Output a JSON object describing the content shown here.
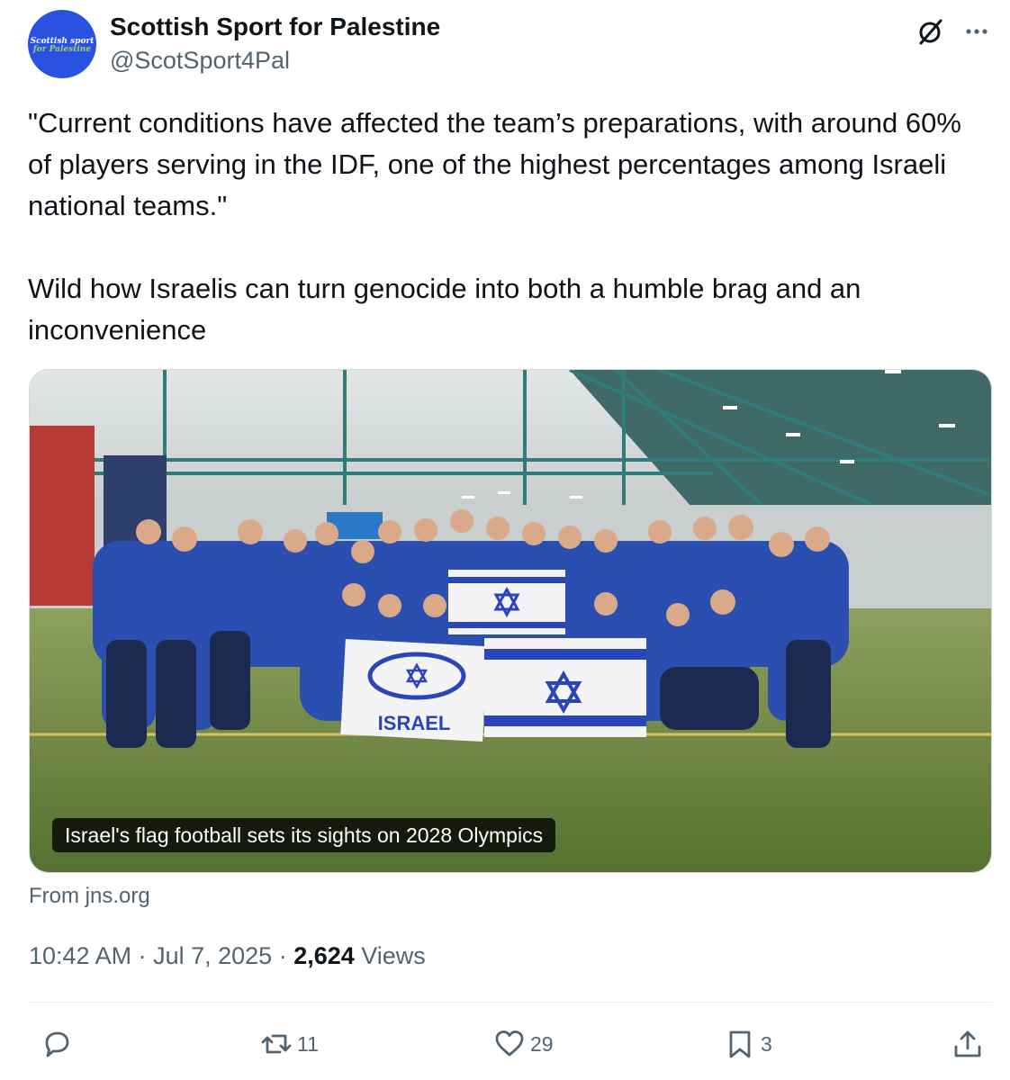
{
  "author": {
    "display_name": "Scottish Sport for Palestine",
    "handle": "@ScotSport4Pal",
    "avatar_line1": "Scottish sport",
    "avatar_line2": "for Palestine"
  },
  "tweet": {
    "text": "\"Current conditions have affected the team’s preparations, with around 60% of players serving in the IDF, one of the highest percentages among Israeli national teams.\"\n\nWild how Israelis can turn genocide into both a humble brag and an inconvenience"
  },
  "card": {
    "caption": "Israel's flag football sets its sights on 2028 Olympics",
    "flag_text": "ISRAEL",
    "source": "From jns.org"
  },
  "meta": {
    "time": "10:42 AM",
    "sep1": " · ",
    "date": "Jul 7, 2025",
    "sep2": " · ",
    "views_count": "2,624",
    "views_label": " Views"
  },
  "actions": {
    "replies": "",
    "reposts": "11",
    "likes": "29",
    "bookmarks": "3"
  },
  "icons": {
    "header": [
      "grok-icon",
      "more-icon"
    ],
    "actions": [
      "reply-icon",
      "repost-icon",
      "like-icon",
      "bookmark-icon",
      "share-icon"
    ]
  },
  "colors": {
    "text": "#0f1419",
    "secondary": "#536471",
    "avatar_bg": "#2a52e0",
    "avatar_accent": "#9bd06b",
    "border": "#cfd9de"
  }
}
